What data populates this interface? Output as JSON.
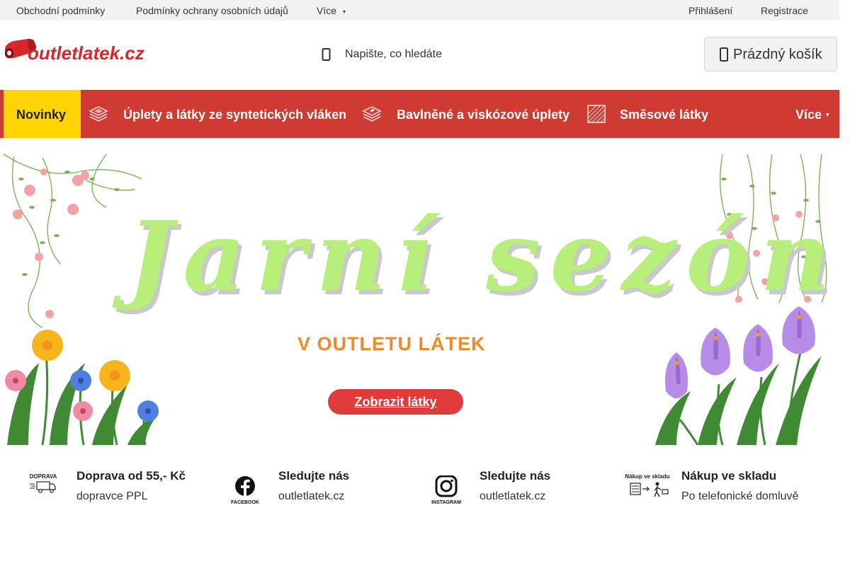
{
  "topbar": {
    "links": [
      "Obchodní podmínky",
      "Podmínky ochrany osobních údajů"
    ],
    "more_label": "Více",
    "more_caret": "▾",
    "login": "Přihlášení",
    "register": "Registrace"
  },
  "header": {
    "logo_text": "outletlatek.cz",
    "search_placeholder": "Napište, co hledáte",
    "cart_label": "Prázdný košík"
  },
  "nav": {
    "first": "Novinky",
    "items": [
      {
        "label": "Úplety a látky ze syntetických vláken",
        "icon": "fabric-stack-icon"
      },
      {
        "label": "Bavlněné a viskózové úplety",
        "icon": "leaf-fabric-icon"
      },
      {
        "label": "Směsové látky",
        "icon": "pattern-square-icon"
      }
    ],
    "more_label": "Více",
    "more_caret": "▾"
  },
  "banner": {
    "title": "Jarní sezóna",
    "subtitle": "V OUTLETU LÁTEK",
    "cta": "Zobrazit látky"
  },
  "features": [
    {
      "icon_text": "DOPRAVA",
      "title": "Doprava od 55,- Kč",
      "subtitle": "dopravce PPL"
    },
    {
      "icon_text": "FACEBOOK",
      "title": "Sledujte nás",
      "subtitle": "outletlatek.cz"
    },
    {
      "icon_text": "INSTAGRAM",
      "title": "Sledujte nás",
      "subtitle": "outletlatek.cz"
    },
    {
      "icon_text": "Nákup ve skladu",
      "title": "Nákup ve skladu",
      "subtitle": "Po telefonické domluvě"
    }
  ],
  "colors": {
    "nav_bg": "#cf3a33",
    "nav_highlight": "#ffd400",
    "title_green": "#b8ee7a",
    "subtitle_orange": "#f08a28",
    "cta_red": "#df3b3b",
    "logo_red": "#d9262b"
  }
}
